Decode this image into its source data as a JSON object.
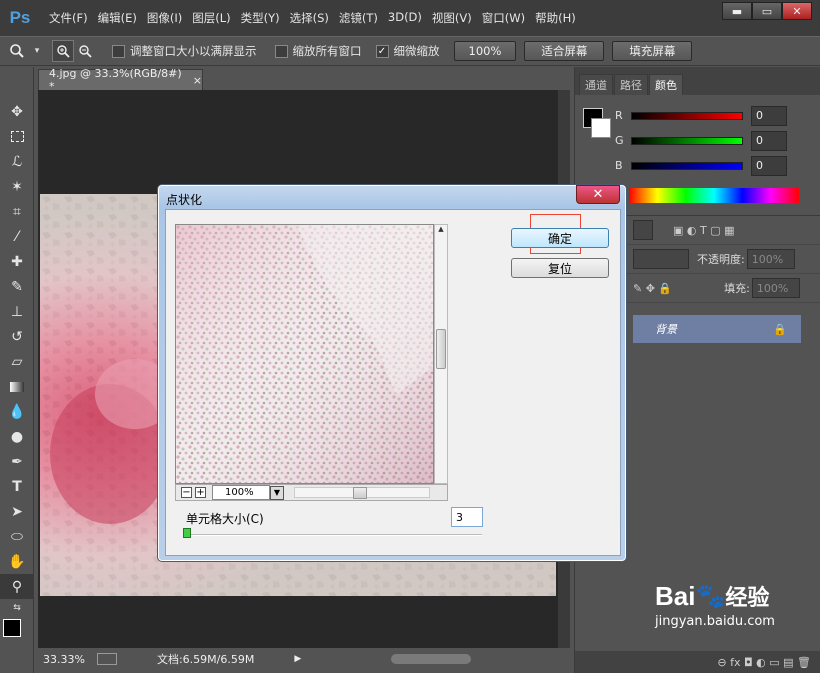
{
  "app": {
    "logo": "Ps"
  },
  "menubar": {
    "items": [
      "文件(F)",
      "编辑(E)",
      "图像(I)",
      "图层(L)",
      "类型(Y)",
      "选择(S)",
      "滤镜(T)",
      "3D(D)",
      "视图(V)",
      "窗口(W)",
      "帮助(H)"
    ]
  },
  "window_controls": {
    "minimize": "▬",
    "maximize": "▭",
    "close": "✕"
  },
  "options": {
    "resize_windows": "调整窗口大小以满屏显示",
    "zoom_all": "缩放所有窗口",
    "scrubby_zoom": "细微缩放",
    "btn_100": "100%",
    "btn_fit": "适合屏幕",
    "btn_fill": "填充屏幕"
  },
  "document": {
    "tab_title": "4.jpg @ 33.3%(RGB/8#) *",
    "tab_close": "×"
  },
  "status": {
    "zoom": "33.33%",
    "doc_size": "文档:6.59M/6.59M"
  },
  "panels": {
    "tabs": [
      "通道",
      "路径",
      "颜色"
    ],
    "color": {
      "r_label": "R",
      "g_label": "G",
      "b_label": "B",
      "r": "0",
      "g": "0",
      "b": "0"
    },
    "layers": {
      "opacity_label": "不透明度:",
      "opacity_value": "100%",
      "fill_label": "填充:",
      "fill_value": "100%",
      "layer_name": "背景",
      "lock_icon": "🔒",
      "bottom_icons": "⊖  fx  ◘  ◐  ▭  ▤  🗑"
    }
  },
  "dialog": {
    "title": "点状化",
    "close": "✕",
    "ok": "确定",
    "reset": "复位",
    "zoom_minus": "−",
    "zoom_plus": "+",
    "zoom_value": "100%",
    "cell_size_label": "单元格大小(C)",
    "cell_size_value": "3"
  },
  "watermark": {
    "brand": "Bai",
    "brand2": "经验",
    "url": "jingyan.baidu.com"
  },
  "colors": {
    "bg": "#535353",
    "dialog_title_bg": "#b9cfe9",
    "ok_highlight": "#e43"
  }
}
